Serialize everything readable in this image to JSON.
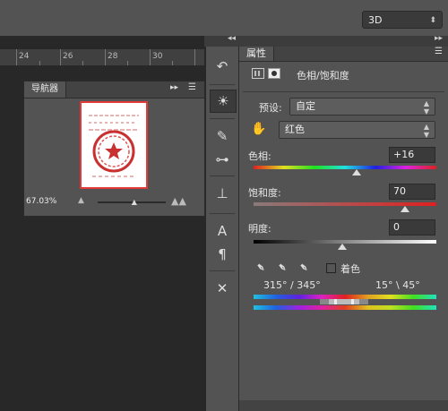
{
  "toolbar": {
    "workspace_value": "3D"
  },
  "ruler": {
    "ticks": [
      "24",
      "26",
      "28",
      "30"
    ]
  },
  "navigator": {
    "title": "导航器",
    "zoom": "67.03%",
    "zoom_level": 0.55,
    "thumbnail_desc": "red seal stamp"
  },
  "tools": [
    "history-icon",
    "adjustments-icon",
    "brush-icon",
    "sliders-icon",
    "stamp-icon",
    "character-icon",
    "paragraph-icon",
    "tools-icon"
  ],
  "properties": {
    "tab_label": "属性",
    "adjustment_title": "色相/饱和度",
    "preset_label": "预设:",
    "preset_value": "自定",
    "channel_value": "红色",
    "hue_label": "色相:",
    "hue_value": "+16",
    "saturation_label": "饱和度:",
    "saturation_value": "70",
    "lightness_label": "明度:",
    "lightness_value": "0",
    "colorize_label": "着色",
    "range_left": "315° / 345°",
    "range_right": "15° \\ 45°"
  },
  "colors": {
    "panel": "#535353",
    "dark": "#282828",
    "stamp": "#e03a3a"
  }
}
